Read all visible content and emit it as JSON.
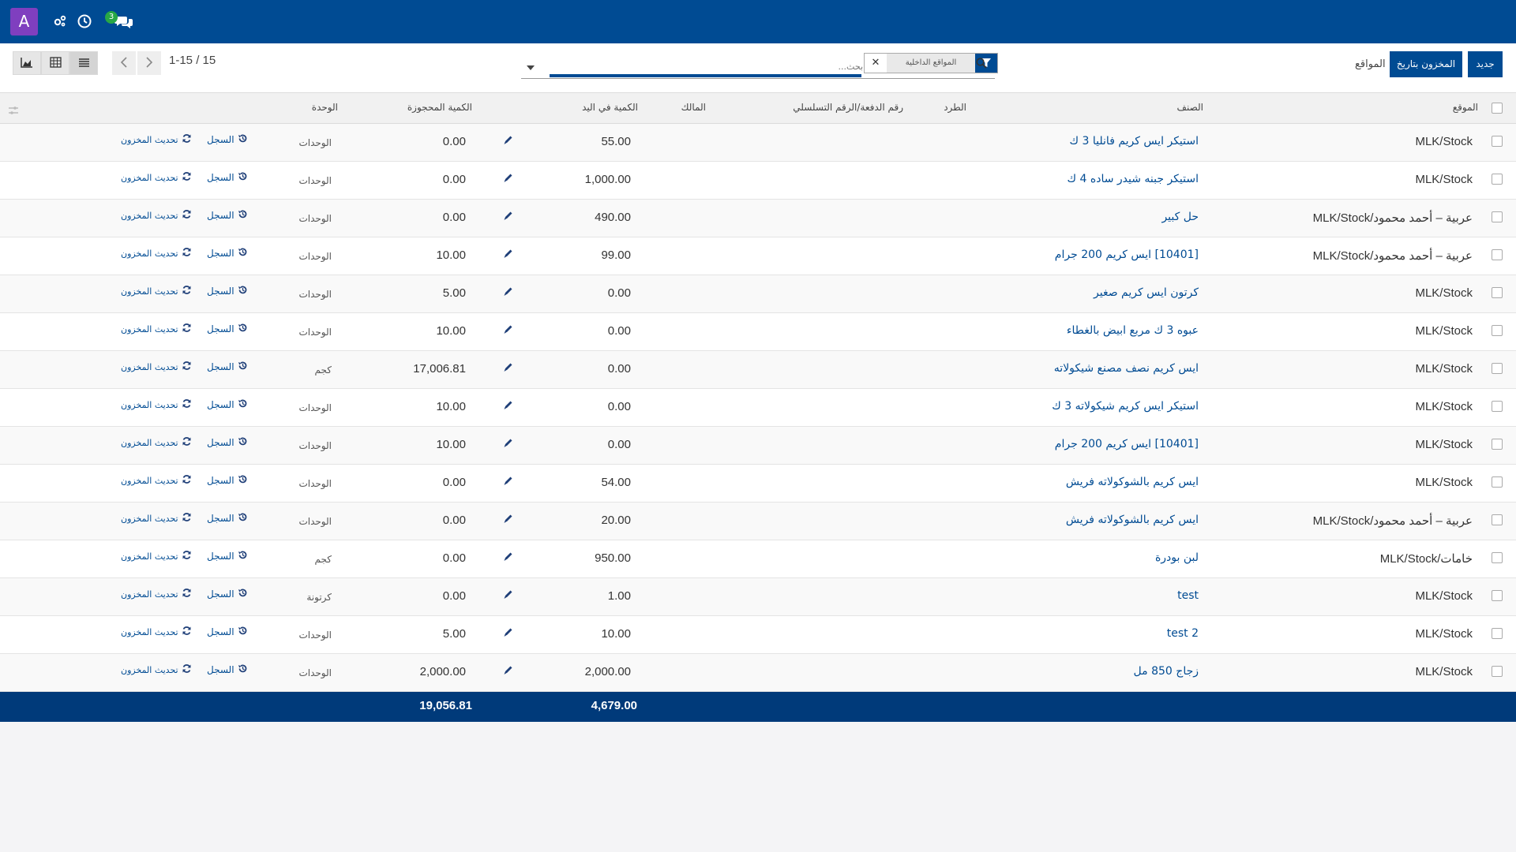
{
  "navbar": {
    "avatar_letter": "A",
    "icons": [
      "settings-icon",
      "clock-icon",
      "chat-icon"
    ],
    "chat_badge": "3"
  },
  "control_panel": {
    "pager_value": "1-15 / 15",
    "search_placeholder": "بحث...",
    "facet_label": "المواقع الداخلية",
    "btn_new": "جديد",
    "btn_inventory_at_date": "المخزون بتاريخ",
    "locations_label": "المواقع"
  },
  "table": {
    "headers": {
      "location": "الموقع",
      "product": "الصنف",
      "package": "الطرد",
      "lot": "رقم الدفعة/الرقم التسلسلي",
      "owner": "المالك",
      "qty_on_hand": "الكمية في اليد",
      "reserved_qty": "الكمية المحجوزة",
      "unit": "الوحدة"
    },
    "history_label": "السجل",
    "update_label": "تحديث المخزون",
    "rows": [
      {
        "location": "MLK/Stock",
        "product": "استيكر ايس كريم فانليا 3 ك",
        "qty": "55.00",
        "reserved": "0.00",
        "unit": "الوحدات"
      },
      {
        "location": "MLK/Stock",
        "product": "استيكر جبنه شيدر ساده 4 ك",
        "qty": "1,000.00",
        "reserved": "0.00",
        "unit": "الوحدات"
      },
      {
        "location": "MLK/Stock/عربية – أحمد محمود",
        "product": "حل كبير",
        "qty": "490.00",
        "reserved": "0.00",
        "unit": "الوحدات"
      },
      {
        "location": "MLK/Stock/عربية – أحمد محمود",
        "product": "[10401] ايس كريم 200 جرام",
        "qty": "99.00",
        "reserved": "10.00",
        "unit": "الوحدات"
      },
      {
        "location": "MLK/Stock",
        "product": "كرتون ايس كريم صغير",
        "qty": "0.00",
        "reserved": "5.00",
        "unit": "الوحدات"
      },
      {
        "location": "MLK/Stock",
        "product": "عبوه 3 ك مربع ابيض بالغطاء",
        "qty": "0.00",
        "reserved": "10.00",
        "unit": "الوحدات"
      },
      {
        "location": "MLK/Stock",
        "product": "ايس كريم نصف مصنع شيكولاته",
        "qty": "0.00",
        "reserved": "17,006.81",
        "unit": "كجم"
      },
      {
        "location": "MLK/Stock",
        "product": "استيكر ايس كريم شيكولاته 3 ك",
        "qty": "0.00",
        "reserved": "10.00",
        "unit": "الوحدات"
      },
      {
        "location": "MLK/Stock",
        "product": "[10401] ايس كريم 200 جرام",
        "qty": "0.00",
        "reserved": "10.00",
        "unit": "الوحدات"
      },
      {
        "location": "MLK/Stock",
        "product": "ايس كريم بالشوكولاته فريش",
        "qty": "54.00",
        "reserved": "0.00",
        "unit": "الوحدات"
      },
      {
        "location": "MLK/Stock/عربية – أحمد محمود",
        "product": "ايس كريم بالشوكولاته فريش",
        "qty": "20.00",
        "reserved": "0.00",
        "unit": "الوحدات"
      },
      {
        "location": "MLK/Stock/خامات",
        "product": "لبن بودرة",
        "qty": "950.00",
        "reserved": "0.00",
        "unit": "كجم"
      },
      {
        "location": "MLK/Stock",
        "product": "test",
        "qty": "1.00",
        "reserved": "0.00",
        "unit": "كرتونة"
      },
      {
        "location": "MLK/Stock",
        "product": "test 2",
        "qty": "10.00",
        "reserved": "5.00",
        "unit": "الوحدات"
      },
      {
        "location": "MLK/Stock",
        "product": "زجاج 850 مل",
        "qty": "2,000.00",
        "reserved": "2,000.00",
        "unit": "الوحدات"
      }
    ],
    "totals": {
      "qty": "4,679.00",
      "reserved": "19,056.81"
    }
  }
}
